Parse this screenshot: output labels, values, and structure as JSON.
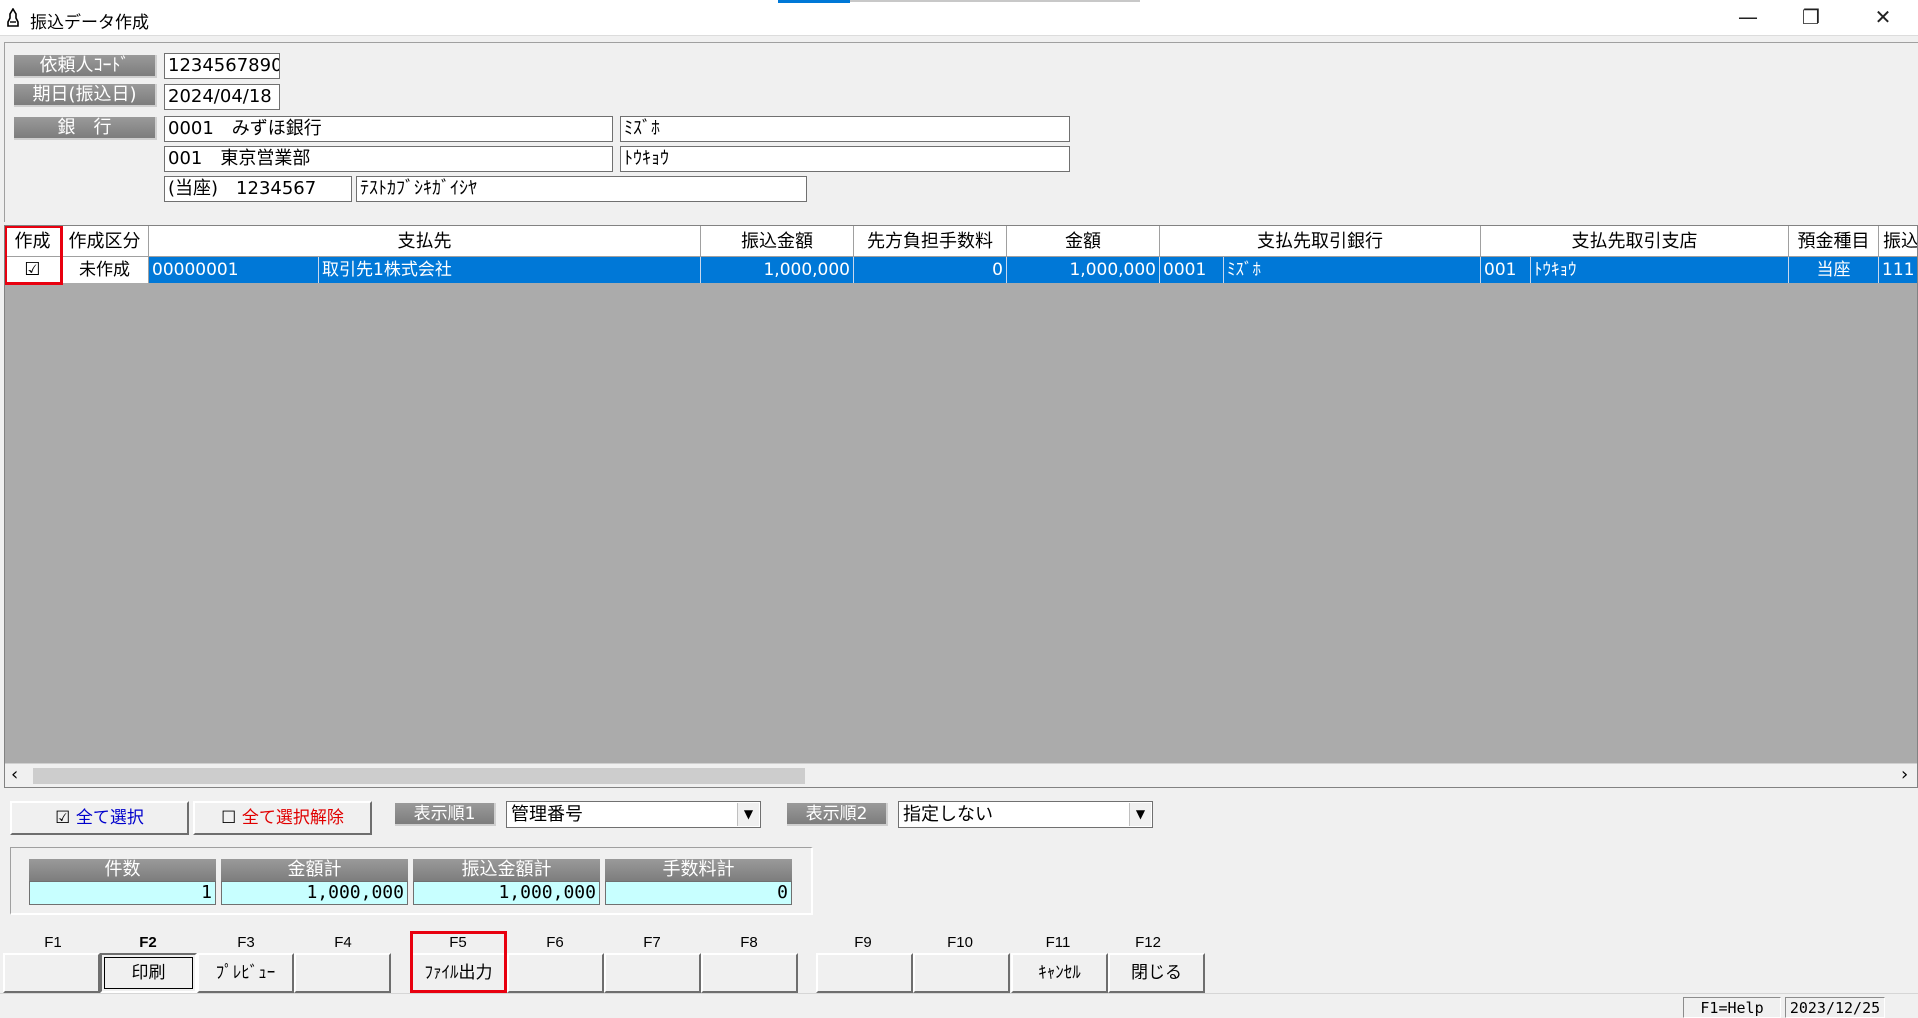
{
  "window": {
    "title": "振込データ作成",
    "min_glyph": "—",
    "restore_glyph": "❐",
    "close_glyph": "✕"
  },
  "header": {
    "requester_code_label": "依頼人ｺｰﾄﾞ",
    "requester_code": "1234567890",
    "date_label": "期日(振込日)",
    "date": "2024/04/18",
    "bank_label": "銀　行",
    "bank": "0001　みずほ銀行",
    "bank_kana": "ﾐｽﾞﾎ",
    "branch": "001　東京営業部",
    "branch_kana": "ﾄｳｷｮｳ",
    "account": "(当座)　1234567",
    "account_name_kana": "ﾃｽﾄｶﾌﾞｼｷｶﾞｲｼﾔ"
  },
  "grid": {
    "columns": [
      "作成",
      "作成区分",
      "支払先",
      "振込金額",
      "先方負担手数料",
      "金額",
      "支払先取引銀行",
      "支払先取引支店",
      "預金種目",
      "振込"
    ],
    "rows": [
      {
        "checked": "☑",
        "status": "未作成",
        "payee_code": "00000001",
        "payee_name": "取引先1株式会社",
        "transfer_amount": "1,000,000",
        "fee": "0",
        "amount": "1,000,000",
        "bank_code": "0001",
        "bank_kana": "ﾐｽﾞﾎ",
        "branch_code": "001",
        "branch_kana": "ﾄｳｷｮｳ",
        "deposit_type": "当座",
        "extra": "111"
      }
    ],
    "scroll_left_glyph": "‹",
    "scroll_right_glyph": "›"
  },
  "controls": {
    "select_all_check": "☑",
    "select_all": "全て選択",
    "deselect_all_check": "☐",
    "deselect_all": "全て選択解除",
    "sort1_label": "表示順1",
    "sort1_value": "管理番号",
    "sort2_label": "表示順2",
    "sort2_value": "指定しない",
    "dropdown_glyph": "▼",
    "select_all_color": "#0000cc",
    "deselect_all_color": "#e00000"
  },
  "totals": {
    "count_label": "件数",
    "count": "1",
    "amount_total_label": "金額計",
    "amount_total": "1,000,000",
    "transfer_total_label": "振込金額計",
    "transfer_total": "1,000,000",
    "fee_total_label": "手数料計",
    "fee_total": "0"
  },
  "function_keys": [
    {
      "key": "F1",
      "label": ""
    },
    {
      "key": "F2",
      "label": "印刷"
    },
    {
      "key": "F3",
      "label": "ﾌﾟﾚﾋﾞｭｰ"
    },
    {
      "key": "F4",
      "label": ""
    },
    {
      "key": "F5",
      "label": "ﾌｧｲﾙ出力"
    },
    {
      "key": "F6",
      "label": ""
    },
    {
      "key": "F7",
      "label": ""
    },
    {
      "key": "F8",
      "label": ""
    },
    {
      "key": "F9",
      "label": ""
    },
    {
      "key": "F10",
      "label": ""
    },
    {
      "key": "F11",
      "label": "ｷｬﾝｾﾙ"
    },
    {
      "key": "F12",
      "label": "閉じる"
    }
  ],
  "status": {
    "help": "F1=Help",
    "date": "2023/12/25"
  },
  "colors": {
    "selection": "#0078d7",
    "highlight_box": "#e8000f",
    "totals_value_bg": "#c8ffff",
    "grid_bg": "#ababab"
  }
}
